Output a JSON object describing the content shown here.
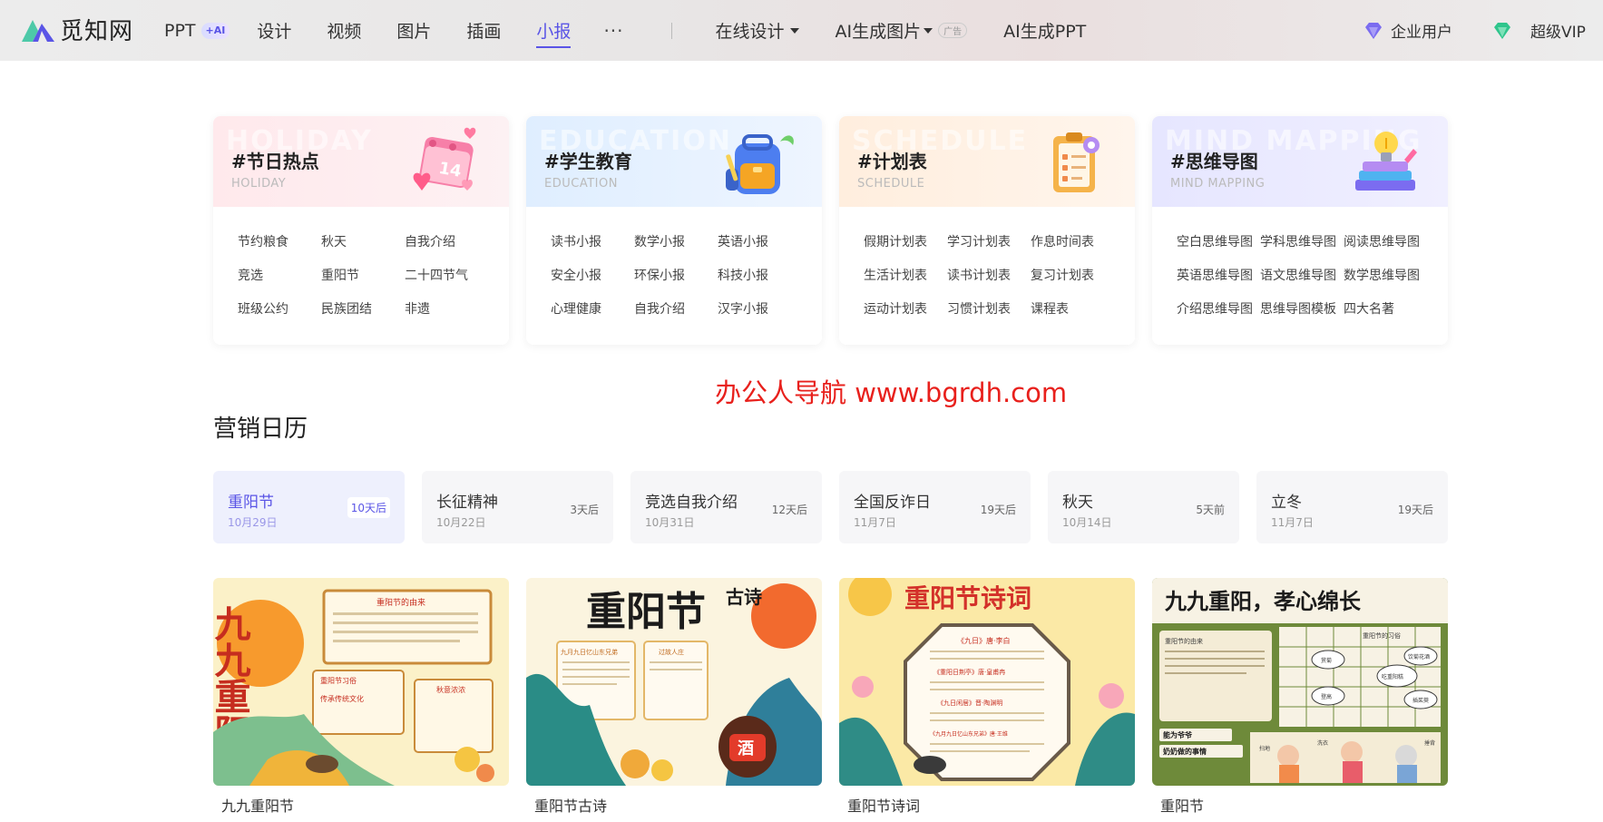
{
  "brand": {
    "name": "觅知网"
  },
  "nav": {
    "items": [
      {
        "label": "PPT",
        "badge": "+AI"
      },
      {
        "label": "设计"
      },
      {
        "label": "视频"
      },
      {
        "label": "图片"
      },
      {
        "label": "插画"
      },
      {
        "label": "小报",
        "active": true
      }
    ],
    "more": "···",
    "online_design": "在线设计",
    "ai_image": "AI生成图片",
    "ad_tag": "广告",
    "ai_ppt": "AI生成PPT",
    "enterprise": "企业用户",
    "vip": "超级VIP"
  },
  "categories": [
    {
      "title": "#节日热点",
      "sub": "HOLIDAY",
      "bg_word": "HOLIDAY",
      "icon": "calendar-hearts-icon",
      "links": [
        "节约粮食",
        "秋天",
        "自我介绍",
        "竞选",
        "重阳节",
        "二十四节气",
        "班级公约",
        "民族团结",
        "非遗"
      ]
    },
    {
      "title": "#学生教育",
      "sub": "EDUCATION",
      "bg_word": "EDUCATION",
      "icon": "backpack-icon",
      "links": [
        "读书小报",
        "数学小报",
        "英语小报",
        "安全小报",
        "环保小报",
        "科技小报",
        "心理健康",
        "自我介绍",
        "汉字小报"
      ]
    },
    {
      "title": "#计划表",
      "sub": "SCHEDULE",
      "bg_word": "SCHEDULE",
      "icon": "clipboard-gear-icon",
      "links": [
        "假期计划表",
        "学习计划表",
        "作息时间表",
        "生活计划表",
        "读书计划表",
        "复习计划表",
        "运动计划表",
        "习惯计划表",
        "课程表"
      ]
    },
    {
      "title": "#思维导图",
      "sub": "MIND MAPPING",
      "bg_word": "MIND MAPPING",
      "icon": "lightbulb-books-icon",
      "links": [
        "空白思维导图",
        "学科思维导图",
        "阅读思维导图",
        "英语思维导图",
        "语文思维导图",
        "数学思维导图",
        "介绍思维导图",
        "思维导图模板",
        "四大名著"
      ]
    }
  ],
  "watermark": "办公人导航  www.bgrdh.com",
  "calendar": {
    "title": "营销日历",
    "items": [
      {
        "name": "重阳节",
        "date": "10月29日",
        "badge": "10天后",
        "active": true
      },
      {
        "name": "长征精神",
        "date": "10月22日",
        "badge": "3天后"
      },
      {
        "name": "竞选自我介绍",
        "date": "10月31日",
        "badge": "12天后"
      },
      {
        "name": "全国反诈日",
        "date": "11月7日",
        "badge": "19天后"
      },
      {
        "name": "秋天",
        "date": "10月14日",
        "badge": "5天前"
      },
      {
        "name": "立冬",
        "date": "11月7日",
        "badge": "19天后"
      }
    ]
  },
  "posters": [
    {
      "caption": "九九重阳节",
      "headline": "九九重阳节",
      "panel_a": "重阳节的由来",
      "panel_b": "重阳节习俗",
      "panel_c": "传承传统文化",
      "panel_d": "秋意浓浓"
    },
    {
      "caption": "重阳节古诗",
      "headline": "重阳节",
      "headline_side": "古诗",
      "panel_a": "九月九日忆山东兄弟",
      "panel_b": "过故人庄",
      "seal": "酒"
    },
    {
      "caption": "重阳节诗词",
      "headline": "重阳节诗词",
      "panel_a": "《九日》唐·李白",
      "panel_b": "《重阳日荆亭》唐·皇甫冉",
      "panel_c": "《九日闲居》晋·陶渊明",
      "panel_d": "《九月九日忆山东兄弟》唐·王维"
    },
    {
      "caption": "重阳节",
      "headline": "九九重阳，孝心绵长",
      "panel_a": "重阳节的由来",
      "panel_b": "重阳节的习俗",
      "panel_c": "能为爷爷",
      "panel_d": "奶奶做的事情",
      "tags": [
        "赏菊",
        "登高",
        "吃重阳糕",
        "饮菊花酒",
        "插茱萸",
        "扫地",
        "洗衣",
        "捶背"
      ]
    }
  ],
  "colors": {
    "accent": "#5a55e6",
    "watermark": "#e8201c"
  }
}
